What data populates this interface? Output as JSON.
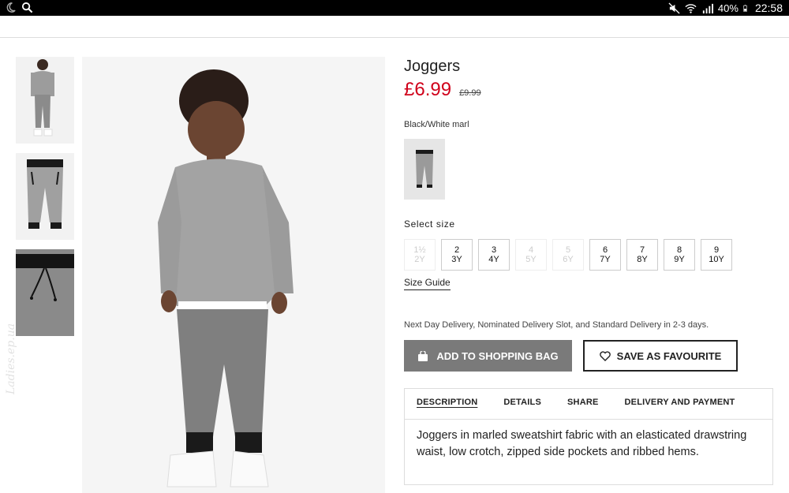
{
  "status_bar": {
    "battery": "40%",
    "time": "22:58",
    "icons": [
      "moon-icon",
      "search-icon",
      "mute-icon",
      "wifi-icon",
      "signal-icon",
      "battery-icon"
    ]
  },
  "product": {
    "title": "Joggers",
    "price": "£6.99",
    "old_price": "£9.99",
    "color_name": "Black/White marl"
  },
  "size_section": {
    "label": "Select size",
    "sizes": [
      {
        "l1": "1½",
        "l2": "2Y",
        "available": false
      },
      {
        "l1": "2",
        "l2": "3Y",
        "available": true
      },
      {
        "l1": "3",
        "l2": "4Y",
        "available": true
      },
      {
        "l1": "4",
        "l2": "5Y",
        "available": false
      },
      {
        "l1": "5",
        "l2": "6Y",
        "available": false
      },
      {
        "l1": "6",
        "l2": "7Y",
        "available": true
      },
      {
        "l1": "7",
        "l2": "8Y",
        "available": true
      },
      {
        "l1": "8",
        "l2": "9Y",
        "available": true
      },
      {
        "l1": "9",
        "l2": "10Y",
        "available": true
      }
    ],
    "guide_label": "Size Guide"
  },
  "delivery_note": "Next Day Delivery, Nominated Delivery Slot, and Standard Delivery in 2-3 days.",
  "buttons": {
    "add_to_bag": "ADD TO SHOPPING BAG",
    "save_favourite": "SAVE AS FAVOURITE"
  },
  "tabs": [
    {
      "label": "DESCRIPTION",
      "active": true
    },
    {
      "label": "DETAILS",
      "active": false
    },
    {
      "label": "SHARE",
      "active": false
    },
    {
      "label": "DELIVERY AND PAYMENT",
      "active": false
    }
  ],
  "description": "Joggers in marled sweatshirt fabric with an elasticated drawstring waist, low crotch, zipped side pockets and ribbed hems.",
  "watermark": "Ladies.ep.ua",
  "colors": {
    "price_red": "#d0021b",
    "bag_button": "#7a7a7a",
    "status_bar": "#000000"
  }
}
